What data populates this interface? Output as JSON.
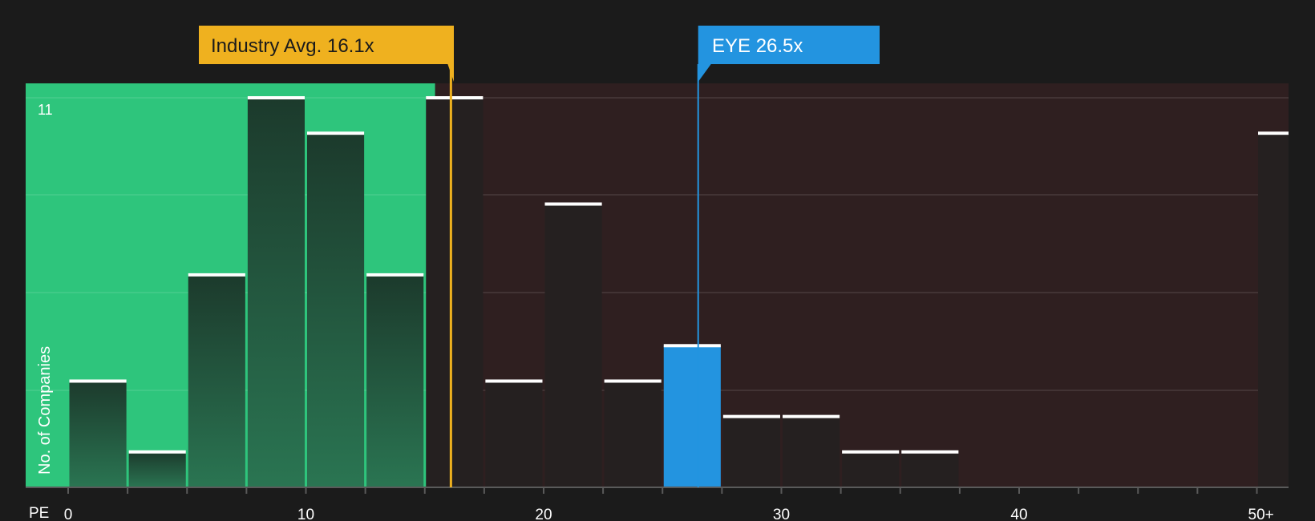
{
  "chart_data": {
    "type": "bar",
    "xlabel": "PE",
    "ylabel": "No. of Companies",
    "x_tick_labels": [
      "0",
      "10",
      "20",
      "30",
      "40",
      "50+"
    ],
    "y_tick_labels": [
      "11"
    ],
    "ylim": [
      0,
      11
    ],
    "bins": [
      {
        "x_start": 0,
        "x_end": 2.5,
        "value": 3
      },
      {
        "x_start": 2.5,
        "x_end": 5,
        "value": 1
      },
      {
        "x_start": 5,
        "x_end": 7.5,
        "value": 6
      },
      {
        "x_start": 7.5,
        "x_end": 10,
        "value": 11
      },
      {
        "x_start": 10,
        "x_end": 12.5,
        "value": 10
      },
      {
        "x_start": 12.5,
        "x_end": 15,
        "value": 6
      },
      {
        "x_start": 15,
        "x_end": 17.5,
        "value": 11
      },
      {
        "x_start": 17.5,
        "x_end": 20,
        "value": 3
      },
      {
        "x_start": 20,
        "x_end": 22.5,
        "value": 8
      },
      {
        "x_start": 22.5,
        "x_end": 25,
        "value": 3
      },
      {
        "x_start": 25,
        "x_end": 27.5,
        "value": 4
      },
      {
        "x_start": 27.5,
        "x_end": 30,
        "value": 2
      },
      {
        "x_start": 30,
        "x_end": 32.5,
        "value": 2
      },
      {
        "x_start": 32.5,
        "x_end": 35,
        "value": 1
      },
      {
        "x_start": 35,
        "x_end": 37.5,
        "value": 1
      },
      {
        "x_start": 50,
        "x_end": 52.5,
        "value": 10
      }
    ],
    "highlight_bin_index": 10,
    "markers": [
      {
        "label": "Industry Avg. 16.1x",
        "value": 16.1,
        "color": "#efb11f"
      },
      {
        "label": "EYE 26.5x",
        "value": 26.5,
        "color": "#2394e0"
      }
    ],
    "fair_region_end": 15.5,
    "colors": {
      "background": "#1b1b1b",
      "fair_region": "#2ec57c",
      "expensive_region": "#2f1f20",
      "bar_in_fair": "#1f3f30",
      "bar_in_expensive": "#252020",
      "bar_highlight": "#2394e0",
      "bar_top": "#ffffff",
      "text": "#ffffff"
    }
  }
}
